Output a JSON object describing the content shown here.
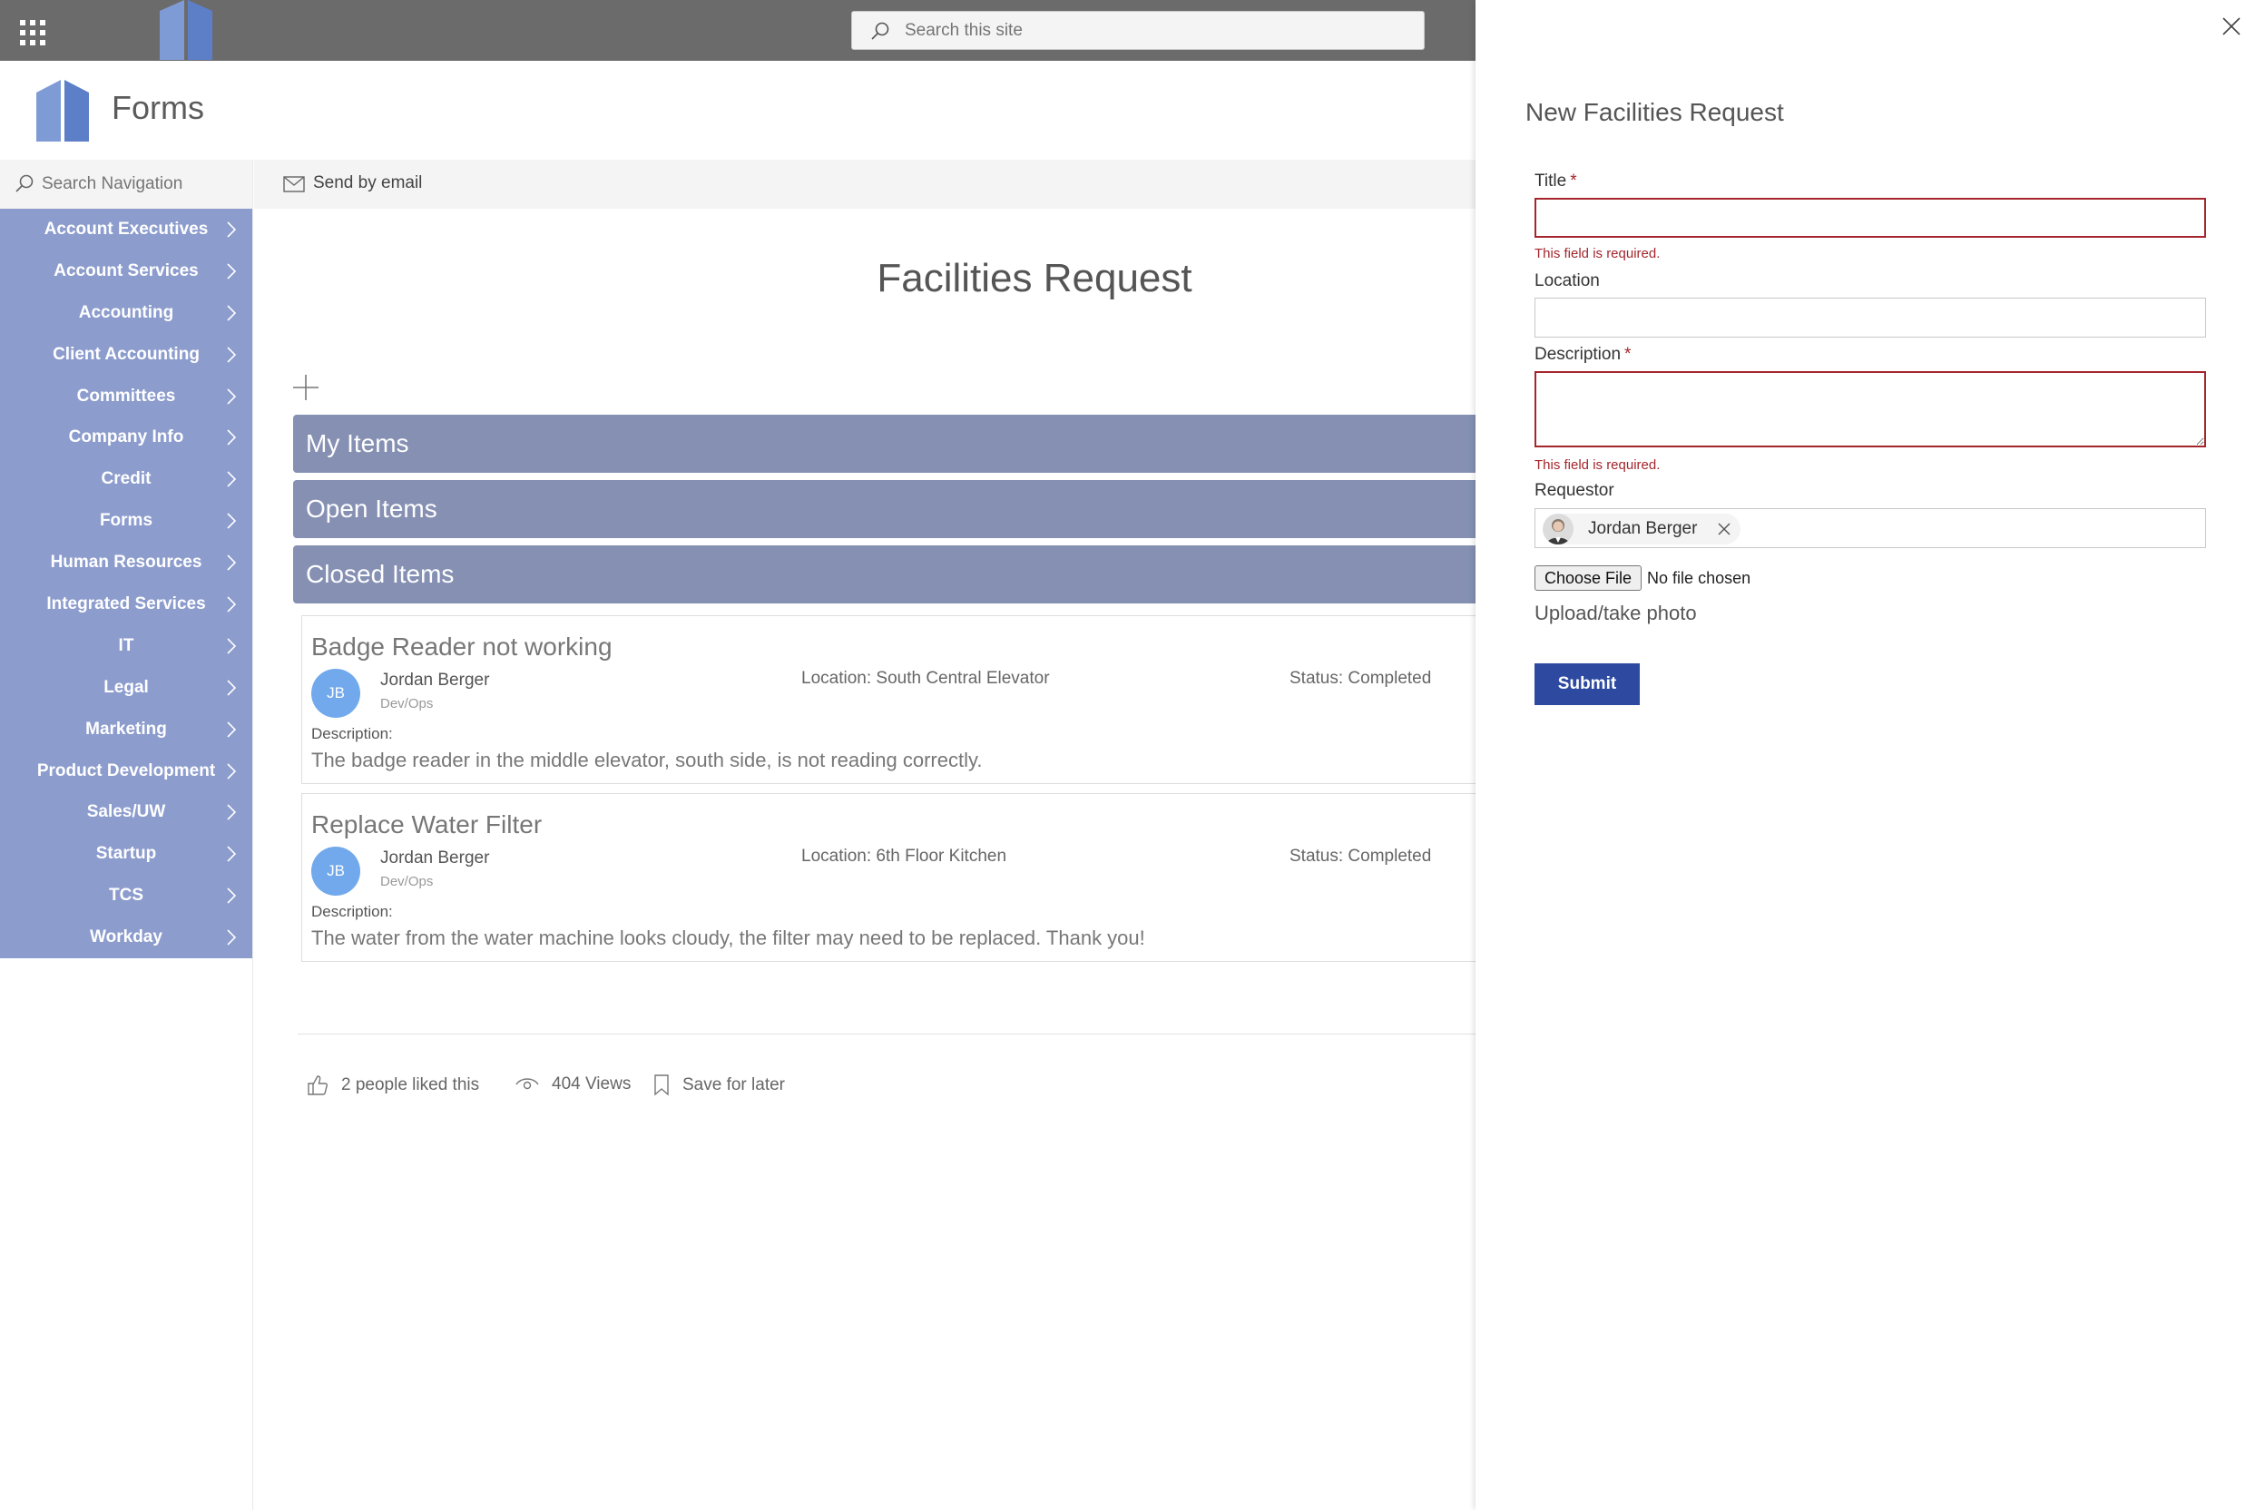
{
  "suite": {
    "search_placeholder": "Search this site"
  },
  "site": {
    "title": "Forms"
  },
  "nav": {
    "search_placeholder": "Search Navigation",
    "items": [
      {
        "label": "Account Executives"
      },
      {
        "label": "Account Services"
      },
      {
        "label": "Accounting"
      },
      {
        "label": "Client Accounting"
      },
      {
        "label": "Committees"
      },
      {
        "label": "Company Info"
      },
      {
        "label": "Credit"
      },
      {
        "label": "Forms"
      },
      {
        "label": "Human Resources"
      },
      {
        "label": "Integrated Services"
      },
      {
        "label": "IT"
      },
      {
        "label": "Legal"
      },
      {
        "label": "Marketing"
      },
      {
        "label": "Product Development"
      },
      {
        "label": "Sales/UW"
      },
      {
        "label": "Startup"
      },
      {
        "label": "TCS"
      },
      {
        "label": "Workday"
      }
    ]
  },
  "command_bar": {
    "send_email_label": "Send by email"
  },
  "main": {
    "heading": "Facilities Request",
    "sections": {
      "my_items": "My Items",
      "open_items": "Open Items",
      "closed_items": "Closed Items"
    },
    "cards": [
      {
        "title": "Badge Reader not working",
        "avatar_initials": "JB",
        "name": "Jordan Berger",
        "department": "Dev/Ops",
        "location": "Location: South Central Elevator",
        "status": "Status: Completed",
        "description_label": "Description:",
        "description": "The badge reader in the middle elevator, south side, is not reading correctly."
      },
      {
        "title": "Replace Water Filter",
        "avatar_initials": "JB",
        "name": "Jordan Berger",
        "department": "Dev/Ops",
        "location": "Location: 6th Floor Kitchen",
        "status": "Status: Completed",
        "description_label": "Description:",
        "description": "The water from the water machine looks cloudy, the filter may need to be replaced. Thank you!"
      }
    ],
    "social": {
      "likes": "2 people liked this",
      "views": "404 Views",
      "save": "Save for later"
    }
  },
  "panel": {
    "title": "New Facilities Request",
    "fields": {
      "title_label": "Title",
      "title_value": "",
      "location_label": "Location",
      "location_value": "",
      "description_label": "Description",
      "description_value": "",
      "required_marker": "*",
      "required_error": "This field is required.",
      "requestor_label": "Requestor",
      "requestor_name": "Jordan Berger",
      "file_button": "Choose File",
      "file_status": "No file chosen",
      "upload_label": "Upload/take photo"
    },
    "submit_label": "Submit"
  },
  "colors": {
    "nav_background": "#8c9ccd",
    "section_bar": "#8590b3",
    "suite_bar": "#6b6b6b",
    "error": "#a4262c",
    "submit": "#2d4aa0",
    "avatar": "#71a9ec"
  },
  "icons": [
    "waffle-icon",
    "brand-logo",
    "search-icon",
    "chevron-right-icon",
    "mail-icon",
    "add-icon",
    "like-icon",
    "views-icon",
    "bookmark-icon",
    "close-icon",
    "remove-icon"
  ]
}
